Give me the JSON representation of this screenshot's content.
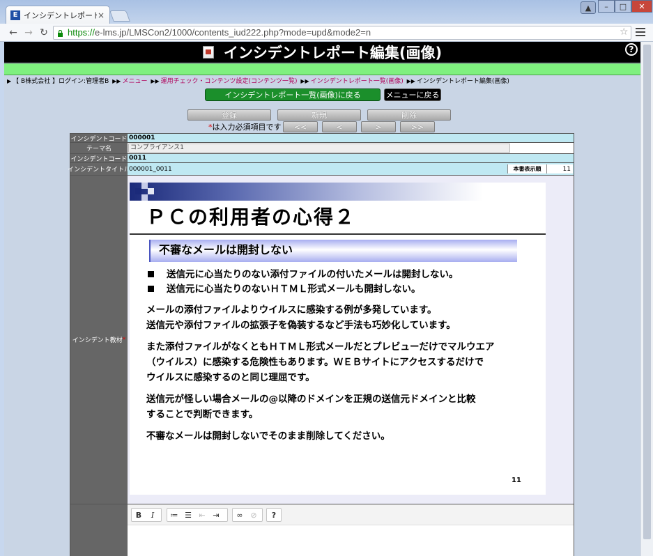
{
  "browser": {
    "tab_title": "インシデントレポート編",
    "favicon_letter": "E",
    "url_scheme": "https://",
    "url_rest": "e-lms.jp/LMSCon2/1000/contents_iud222.php?mode=upd&mode2=n"
  },
  "page": {
    "title": "インシデントレポート編集(画像)",
    "help_glyph": "?"
  },
  "breadcrumb": {
    "user": "【 B株式会社 】ログイン:管理者B",
    "items": [
      "メニュー",
      "運用チェック・コンテンツ設定(コンテンツ一覧)",
      "インシデントレポート一覧(画像)"
    ],
    "current": "インシデントレポート編集(画像)"
  },
  "nav_buttons": {
    "back_to_list": "インシデントレポート一覧(画像)に戻る",
    "back_to_menu": "メニューに戻る"
  },
  "actions": {
    "register": "登録",
    "new": "新規",
    "delete": "削除",
    "first": "<<",
    "prev": "<",
    "next": ">",
    "last": ">>",
    "required_note_star": "*",
    "required_note": "は入力必須項目です"
  },
  "form": {
    "incident_code_label": "インシデントコード",
    "incident_code_value": "000001",
    "theme_label": "テーマ名",
    "theme_value": "コンプライアンス1",
    "incident_code2_label": "インシデントコード",
    "incident_code2_value": "0011",
    "incident_title_label": "インシデントタイトル",
    "incident_title_value": "000001_0011",
    "display_order_label": "本番表示順",
    "display_order_value": "11",
    "material_label": "インシデント教材",
    "material_required": "*"
  },
  "slide": {
    "title": "ＰＣの利用者の心得２",
    "subhead": "不審なメールは開封しない",
    "bullets": [
      "送信元に心当たりのない添付ファイルの付いたメールは開封しない。",
      "送信元に心当たりのないＨＴＭＬ形式メールも開封しない。"
    ],
    "para1_line1": "メールの添付ファイルよりウイルスに感染する例が多発しています。",
    "para1_line2": "送信元や添付ファイルの拡張子を偽装するなど手法も巧妙化しています。",
    "para2_line1": "また添付ファイルがなくともＨＴＭＬ形式メールだとプレビューだけでマルウエア",
    "para2_line2": "（ウイルス）に感染する危険性もあります。ＷＥＢサイトにアクセスするだけで",
    "para2_line3": "ウイルスに感染するのと同じ理屈です。",
    "para3_line1": "送信元が怪しい場合メールの@以降のドメインを正規の送信元ドメインと比較",
    "para3_line2": "することで判断できます。",
    "para4": "不審なメールは開封しないでそのまま削除してください。",
    "page_number": "11"
  },
  "editor_toolbar": {
    "bold": "B",
    "italic": "I",
    "help": "?"
  },
  "colors": {
    "header_bg": "#000000",
    "green_bar": "#7ff07f",
    "back_button_green": "#1b8f2b",
    "value_cell_blue": "#bfe8f2",
    "label_cell_gray": "#666666",
    "link_magenta": "#b0005a"
  }
}
